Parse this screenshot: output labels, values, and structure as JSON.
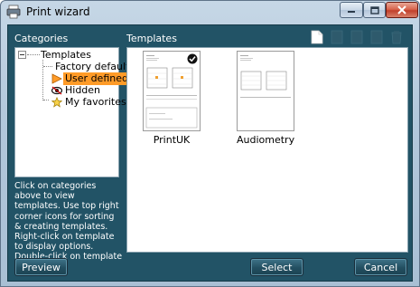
{
  "window": {
    "title": "Print wizard"
  },
  "categories": {
    "label": "Categories",
    "tree": {
      "root": "Templates",
      "items": [
        {
          "label": "Factory defaults",
          "icon": "blank",
          "selected": false
        },
        {
          "label": "User defined",
          "icon": "arrow-right-icon",
          "selected": true
        },
        {
          "label": "Hidden",
          "icon": "eye-icon",
          "selected": false
        },
        {
          "label": "My favorites",
          "icon": "star-icon",
          "selected": false
        }
      ]
    },
    "help": "Click on categories above to view templates. Use top right corner icons for sorting & creating templates. Right-click on template to display options. Double-click on template to preview."
  },
  "templates": {
    "label": "Templates",
    "items": [
      {
        "name": "PrintUK",
        "checked": true
      },
      {
        "name": "Audiometry",
        "checked": false
      }
    ]
  },
  "buttons": {
    "preview": "Preview",
    "select": "Select",
    "cancel": "Cancel"
  },
  "colors": {
    "panel": "#225366",
    "selection": "#ff9b28"
  }
}
